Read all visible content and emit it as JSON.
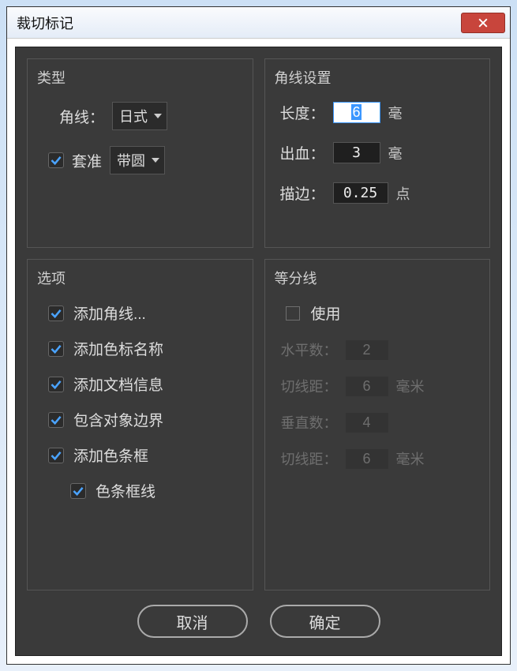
{
  "window": {
    "title": "裁切标记"
  },
  "type_panel": {
    "title": "类型",
    "corner_label": "角线：",
    "corner_select": "日式",
    "register_checked": true,
    "register_label": "套准",
    "register_select": "带圆"
  },
  "corner_settings": {
    "title": "角线设置",
    "length_label": "长度：",
    "length_value": "6",
    "length_unit": "毫",
    "bleed_label": "出血：",
    "bleed_value": "3",
    "bleed_unit": "毫",
    "stroke_label": "描边：",
    "stroke_value": "0.25",
    "stroke_unit": "点"
  },
  "options_panel": {
    "title": "选项",
    "items": [
      {
        "label": "添加角线...",
        "checked": true
      },
      {
        "label": "添加色标名称",
        "checked": true
      },
      {
        "label": "添加文档信息",
        "checked": true
      },
      {
        "label": "包含对象边界",
        "checked": true
      },
      {
        "label": "添加色条框",
        "checked": true
      }
    ],
    "sub_item": {
      "label": "色条框线",
      "checked": true
    }
  },
  "division_panel": {
    "title": "等分线",
    "use_label": "使用",
    "use_checked": false,
    "h_count_label": "水平数：",
    "h_count_value": "2",
    "h_dist_label": "切线距：",
    "h_dist_value": "6",
    "h_dist_unit": "毫米",
    "v_count_label": "垂直数：",
    "v_count_value": "4",
    "v_dist_label": "切线距：",
    "v_dist_value": "6",
    "v_dist_unit": "毫米"
  },
  "buttons": {
    "cancel": "取消",
    "ok": "确定"
  }
}
